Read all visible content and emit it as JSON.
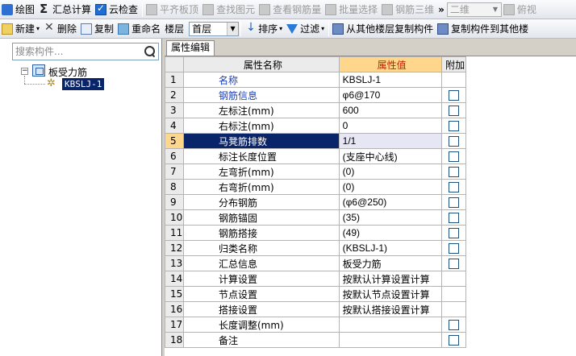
{
  "toolbar_top": {
    "draw": "绘图",
    "sum_calc": "汇总计算",
    "cloud_check": "云检查",
    "flat_slab_top": "平齐板顶",
    "find_element": "查找图元",
    "view_rebar": "查看钢筋量",
    "batch_select": "批量选择",
    "rebar_3d": "钢筋三维",
    "more": "»",
    "view_mode": "二维",
    "view_mode_caret": "▼",
    "overlook": "俯视"
  },
  "toolbar_second": {
    "new": "新建",
    "delete": "删除",
    "copy": "复制",
    "rename": "重命名",
    "floor_label": "楼层",
    "floor_value": "首层",
    "floor_caret": "▼",
    "sort": "排序",
    "filter": "过滤",
    "copy_from_other_floor": "从其他楼层复制构件",
    "copy_to_other": "复制构件到其他楼",
    "caret": "▾"
  },
  "left": {
    "search_placeholder": "搜索构件...",
    "tree_toggle": "−",
    "tree_root": "板受力筋",
    "tree_child": "KBSLJ-1"
  },
  "tab": {
    "label": "属性编辑"
  },
  "grid": {
    "headers": {
      "name": "属性名称",
      "value": "属性值",
      "extra": "附加"
    },
    "rows": [
      {
        "num": "1",
        "name": "名称",
        "value": "KBSLJ-1",
        "checkbox": false
      },
      {
        "num": "2",
        "name": "钢筋信息",
        "value": "φ6@170",
        "checkbox": true
      },
      {
        "num": "3",
        "name": "左标注(mm)",
        "value": "600",
        "checkbox": true
      },
      {
        "num": "4",
        "name": "右标注(mm)",
        "value": "0",
        "checkbox": true
      },
      {
        "num": "5",
        "name": "马凳筋排数",
        "value": "1/1",
        "checkbox": true
      },
      {
        "num": "6",
        "name": "标注长度位置",
        "value": "(支座中心线)",
        "checkbox": true
      },
      {
        "num": "7",
        "name": "左弯折(mm)",
        "value": "(0)",
        "checkbox": true
      },
      {
        "num": "8",
        "name": "右弯折(mm)",
        "value": "(0)",
        "checkbox": true
      },
      {
        "num": "9",
        "name": "分布钢筋",
        "value": "(φ6@250)",
        "checkbox": true
      },
      {
        "num": "10",
        "name": "钢筋锚固",
        "value": "(35)",
        "checkbox": true
      },
      {
        "num": "11",
        "name": "钢筋搭接",
        "value": "(49)",
        "checkbox": true
      },
      {
        "num": "12",
        "name": "归类名称",
        "value": "(KBSLJ-1)",
        "checkbox": true
      },
      {
        "num": "13",
        "name": "汇总信息",
        "value": "板受力筋",
        "checkbox": true
      },
      {
        "num": "14",
        "name": "计算设置",
        "value": "按默认计算设置计算",
        "checkbox": false
      },
      {
        "num": "15",
        "name": "节点设置",
        "value": "按默认节点设置计算",
        "checkbox": false
      },
      {
        "num": "16",
        "name": "搭接设置",
        "value": "按默认搭接设置计算",
        "checkbox": false
      },
      {
        "num": "17",
        "name": "长度调整(mm)",
        "value": "",
        "checkbox": true
      },
      {
        "num": "18",
        "name": "备注",
        "value": "",
        "checkbox": true
      }
    ]
  }
}
